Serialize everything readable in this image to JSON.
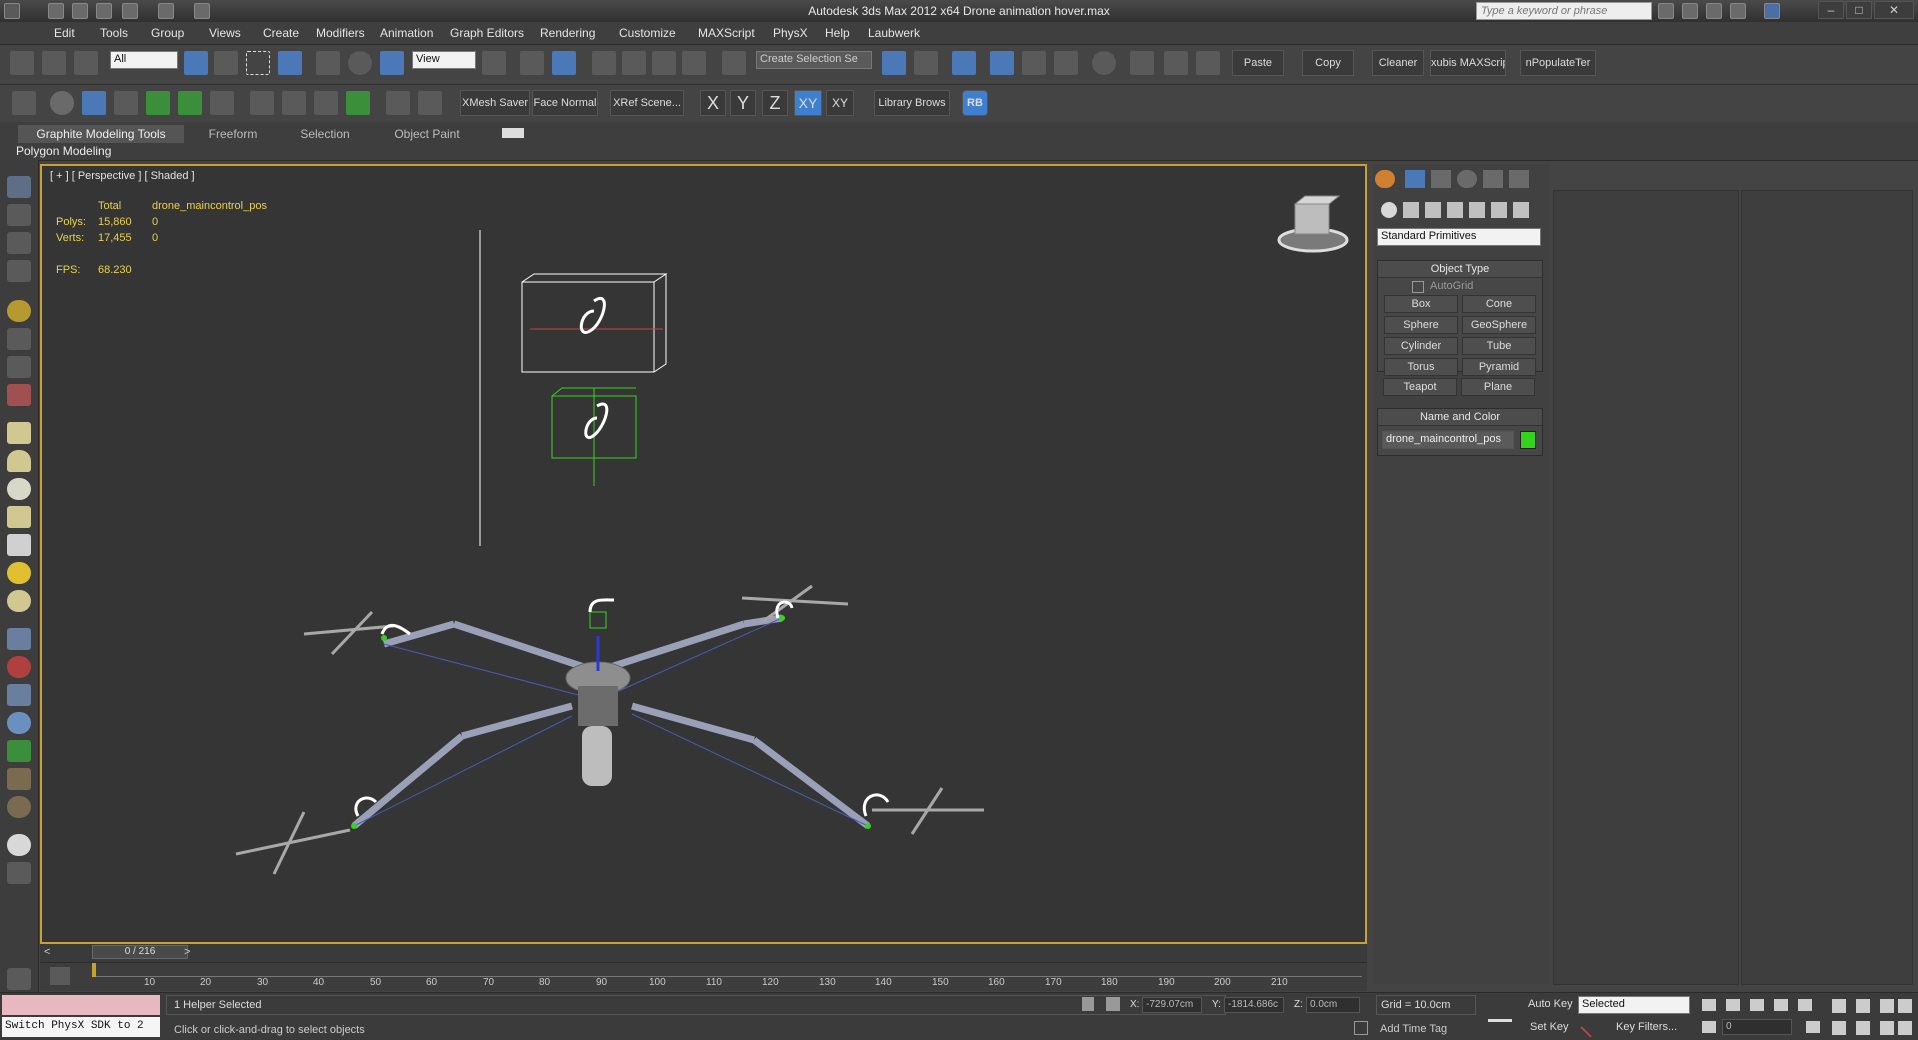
{
  "window": {
    "title": "Autodesk 3ds Max  2012 x64     Drone animation hover.max",
    "search_placeholder": "Type a keyword or phrase",
    "minimize": "–",
    "maximize": "□",
    "close": "✕"
  },
  "menu": [
    "Edit",
    "Tools",
    "Group",
    "Views",
    "Create",
    "Modifiers",
    "Animation",
    "Graph Editors",
    "Rendering",
    "Customize",
    "MAXScript",
    "PhysX",
    "Help",
    "Laubwerk"
  ],
  "toolbar1": {
    "selection_filter": "All",
    "ref_coord": "View",
    "named_selection": "Create Selection Se",
    "paste": "Paste",
    "copy": "Copy",
    "cleaner": "Cleaner",
    "xubis": "xubis MAXScrip",
    "populate": "nPopulateTer"
  },
  "toolbar2": {
    "xmesh": "XMesh Saver",
    "face_normal": "Face Normal",
    "xref": "XRef Scene...",
    "axis_x": "X",
    "axis_y": "Y",
    "axis_z": "Z",
    "axis_xy": "XY",
    "axis_xy2": "XY",
    "library": "Library Brows",
    "rb": "RB"
  },
  "ribbon": {
    "tabs": [
      "Graphite Modeling Tools",
      "Freeform",
      "Selection",
      "Object Paint"
    ],
    "panel": "Polygon Modeling"
  },
  "viewport": {
    "label": "[ + ] [ Perspective ] [ Shaded ]",
    "stats": {
      "total_label": "Total",
      "object_name": "drone_maincontrol_pos",
      "polys_label": "Polys:",
      "polys_total": "15,860",
      "polys_sel": "0",
      "verts_label": "Verts:",
      "verts_total": "17,455",
      "verts_sel": "0",
      "fps_label": "FPS:",
      "fps_value": "68.230"
    }
  },
  "command_panel": {
    "category": "Standard Primitives",
    "object_type_title": "Object Type",
    "autogrid": "AutoGrid",
    "primitives": [
      "Box",
      "Cone",
      "Sphere",
      "GeoSphere",
      "Cylinder",
      "Tube",
      "Torus",
      "Pyramid",
      "Teapot",
      "Plane"
    ],
    "name_color_title": "Name and Color",
    "object_name": "drone_maincontrol_pos",
    "object_color": "#35d41c"
  },
  "timeline": {
    "frame": "0 / 216",
    "prev": "<",
    "next": ">",
    "ticks": [
      "10",
      "20",
      "30",
      "40",
      "50",
      "60",
      "70",
      "80",
      "90",
      "100",
      "110",
      "120",
      "130",
      "140",
      "150",
      "160",
      "170",
      "180",
      "190",
      "200",
      "210"
    ]
  },
  "status": {
    "maxscript_pink": "",
    "maxscript_white": "Switch PhysX SDK to 2",
    "selected": "1 Helper Selected",
    "prompt": "Click or click-and-drag to select objects",
    "x_label": "X:",
    "x_value": "-729.07cm",
    "y_label": "Y:",
    "y_value": "-1814.686c",
    "z_label": "Z:",
    "z_value": "0.0cm",
    "grid": "Grid = 10.0cm",
    "add_time_tag": "Add Time Tag",
    "auto_key": "Auto Key",
    "set_key": "Set Key",
    "key_mode": "Selected",
    "key_filters": "Key Filters...",
    "frame_field": "0"
  }
}
